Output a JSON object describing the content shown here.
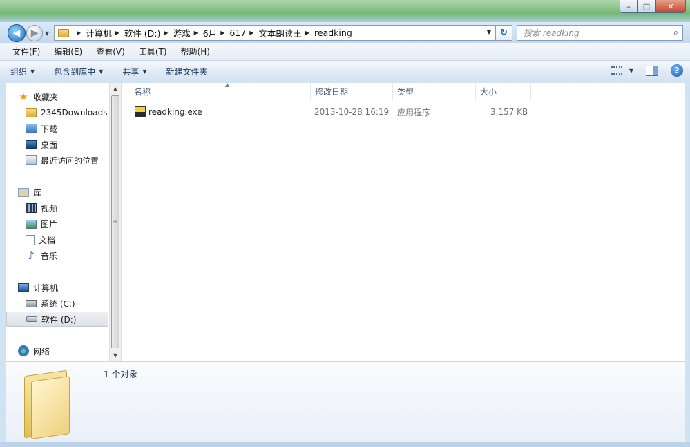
{
  "window": {
    "minimize_glyph": "–",
    "maximize_glyph": "□",
    "close_glyph": "✕"
  },
  "address_bar": {
    "crumbs": [
      "计算机",
      "软件 (D:)",
      "游戏",
      "6月",
      "617",
      "文本朗读王",
      "readking"
    ],
    "search_placeholder": "搜索 readking"
  },
  "menu": {
    "items": [
      "文件(F)",
      "编辑(E)",
      "查看(V)",
      "工具(T)",
      "帮助(H)"
    ]
  },
  "toolbar": {
    "organize": "组织",
    "include_in_library": "包含到库中",
    "share": "共享",
    "new_folder": "新建文件夹",
    "help_glyph": "?"
  },
  "navigation": {
    "favorites": "收藏夹",
    "favorites_items": [
      "2345Downloads",
      "下载",
      "桌面",
      "最近访问的位置"
    ],
    "libraries": "库",
    "library_items": [
      "视频",
      "图片",
      "文档",
      "音乐"
    ],
    "computer": "计算机",
    "drives": [
      "系统 (C:)",
      "软件 (D:)"
    ],
    "network": "网络"
  },
  "file_list": {
    "columns": [
      "名称",
      "修改日期",
      "类型",
      "大小"
    ],
    "rows": [
      {
        "name": "readking.exe",
        "modified": "2013-10-28 16:19",
        "type": "应用程序",
        "size": "3,157 KB"
      }
    ]
  },
  "details": {
    "count": "1 个对象"
  },
  "colors": {
    "selection_bg": "#dde1e6",
    "toolbar_text": "#1e395b",
    "accent_blue": "#1f6fc1"
  },
  "icons": {
    "back": "arrow-left-icon",
    "forward": "arrow-right-icon",
    "refresh": "refresh-icon",
    "search": "search-icon",
    "exe": "exe-file-icon",
    "folder": "folder-icon"
  }
}
